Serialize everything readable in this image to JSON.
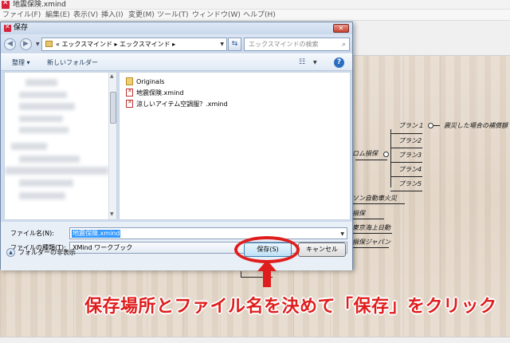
{
  "app": {
    "title": "地震保険.xmind",
    "menu": [
      "ファイル(F)",
      "編集(E)",
      "表示(V)",
      "挿入(I)",
      "変更(M)",
      "ツール(T)",
      "ウィンドウ(W)",
      "ヘルプ(H)"
    ]
  },
  "mindmap": {
    "branch_partial": "ロム損保",
    "plans": [
      "プラン１",
      "プラン2",
      "プラン3",
      "プラン4",
      "プラン5"
    ],
    "plan1_note": "震災した場合の補償額",
    "topics_partial": [
      "ソン自動車火災",
      "損保",
      "東京海上日動",
      "損保ジャパン"
    ]
  },
  "dialog": {
    "title": "保存",
    "address_text": "« エックスマインド ▸ エックスマインド ▸",
    "search_placeholder": "エックスマインドの検索",
    "organize_label": "整理 ▾",
    "new_folder_label": "新しいフォルダー",
    "files": [
      {
        "name": "Originals",
        "kind": "folder"
      },
      {
        "name": "地震保険.xmind",
        "kind": "xmind"
      },
      {
        "name": "涼しいアイテム空調服？.xmind",
        "kind": "xmind"
      }
    ],
    "filename_label": "ファイル名(N):",
    "filename_value": "地震保険.xmind",
    "filetype_label": "ファイルの種類(T):",
    "filetype_value": "XMind ワークブック",
    "hide_folders_label": "フォルダーの非表示",
    "save_label": "保存(S)",
    "cancel_label": "キャンセル"
  },
  "annotation": {
    "caption": "保存場所とファイル名を決めて「保存」をクリック",
    "color": "#e01d1d"
  }
}
